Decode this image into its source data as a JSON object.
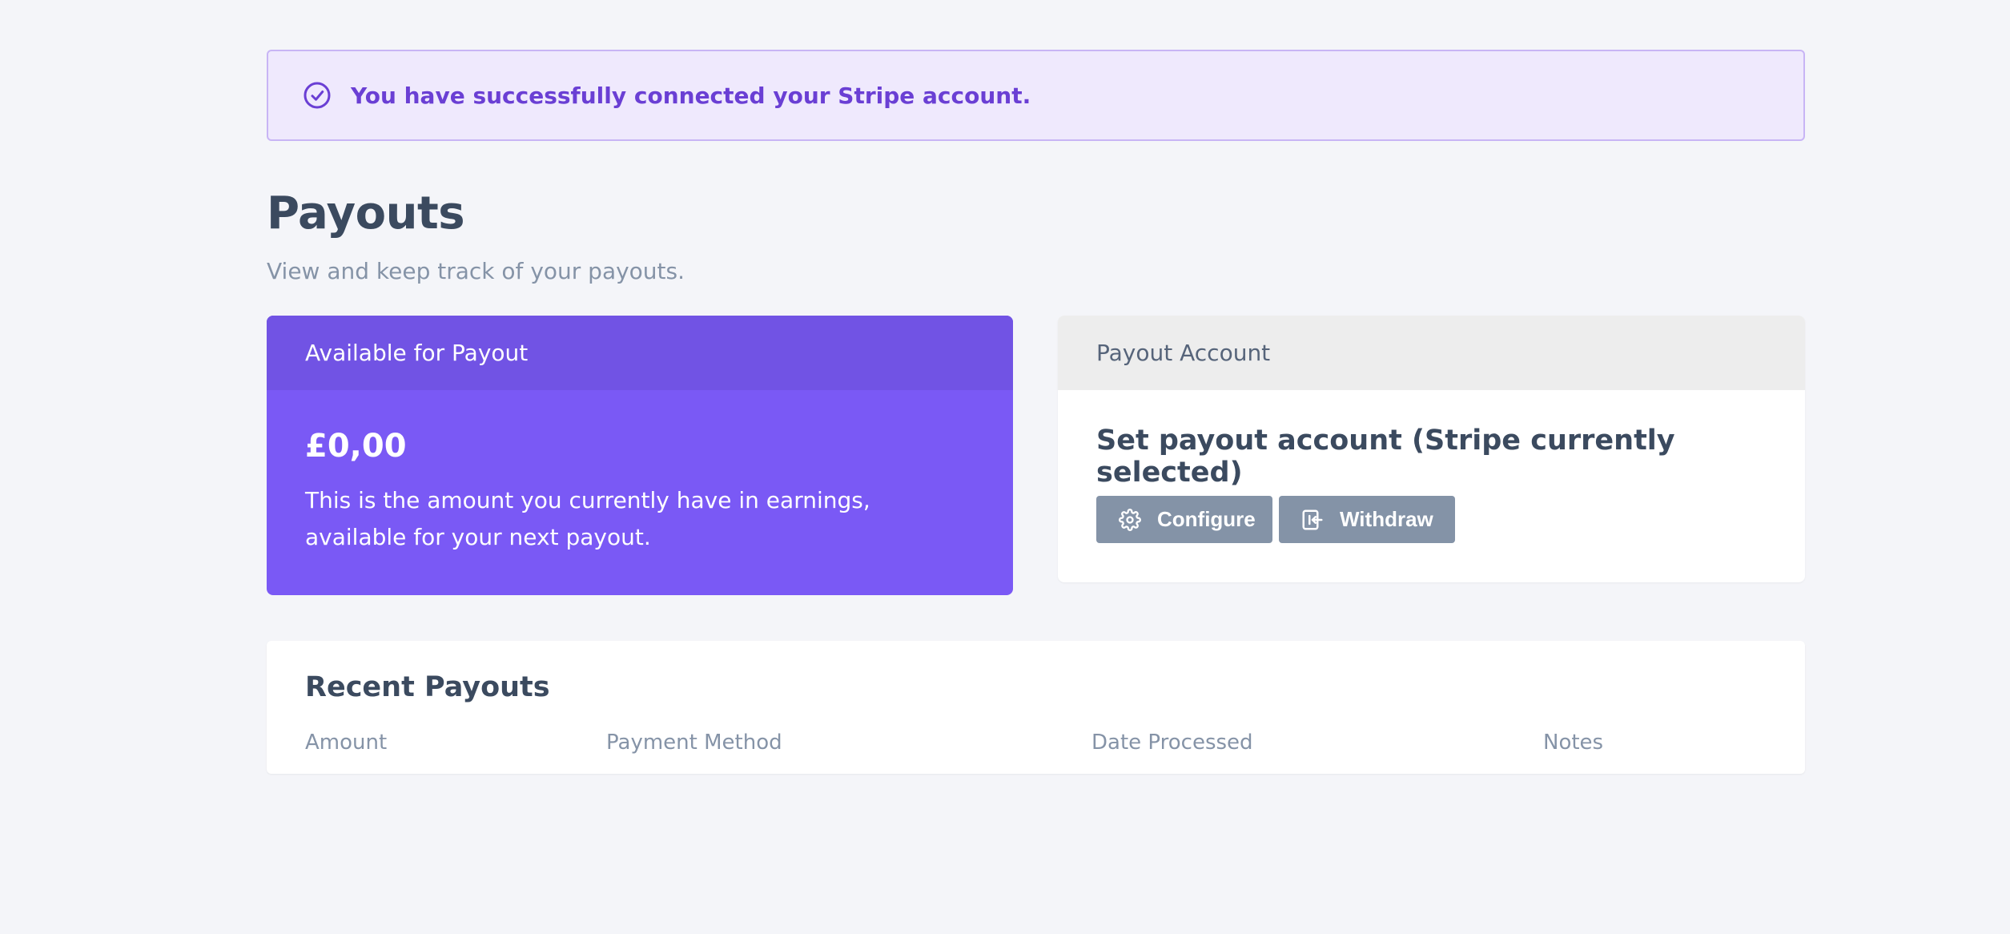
{
  "alert": {
    "icon": "check-circle-icon",
    "message": "You have successfully connected your Stripe account."
  },
  "header": {
    "title": "Payouts",
    "subtitle": "View and keep track of your payouts."
  },
  "available_card": {
    "heading": "Available for Payout",
    "amount": "£0,00",
    "description": "This is the amount you currently have in earnings, available for your next payout."
  },
  "account_card": {
    "heading": "Payout Account",
    "title": "Set payout account (Stripe currently selected)",
    "configure_label": "Configure",
    "configure_icon": "gear-icon",
    "withdraw_label": "Withdraw",
    "withdraw_icon": "withdraw-icon"
  },
  "recent_payouts": {
    "title": "Recent Payouts",
    "columns": [
      "Amount",
      "Payment Method",
      "Date Processed",
      "Notes"
    ]
  },
  "colors": {
    "accent": "#7a59f5",
    "accent_dark": "#7153e4",
    "alert_bg": "#efe9fd",
    "alert_text": "#6a3fd4",
    "button": "#8493a7"
  }
}
